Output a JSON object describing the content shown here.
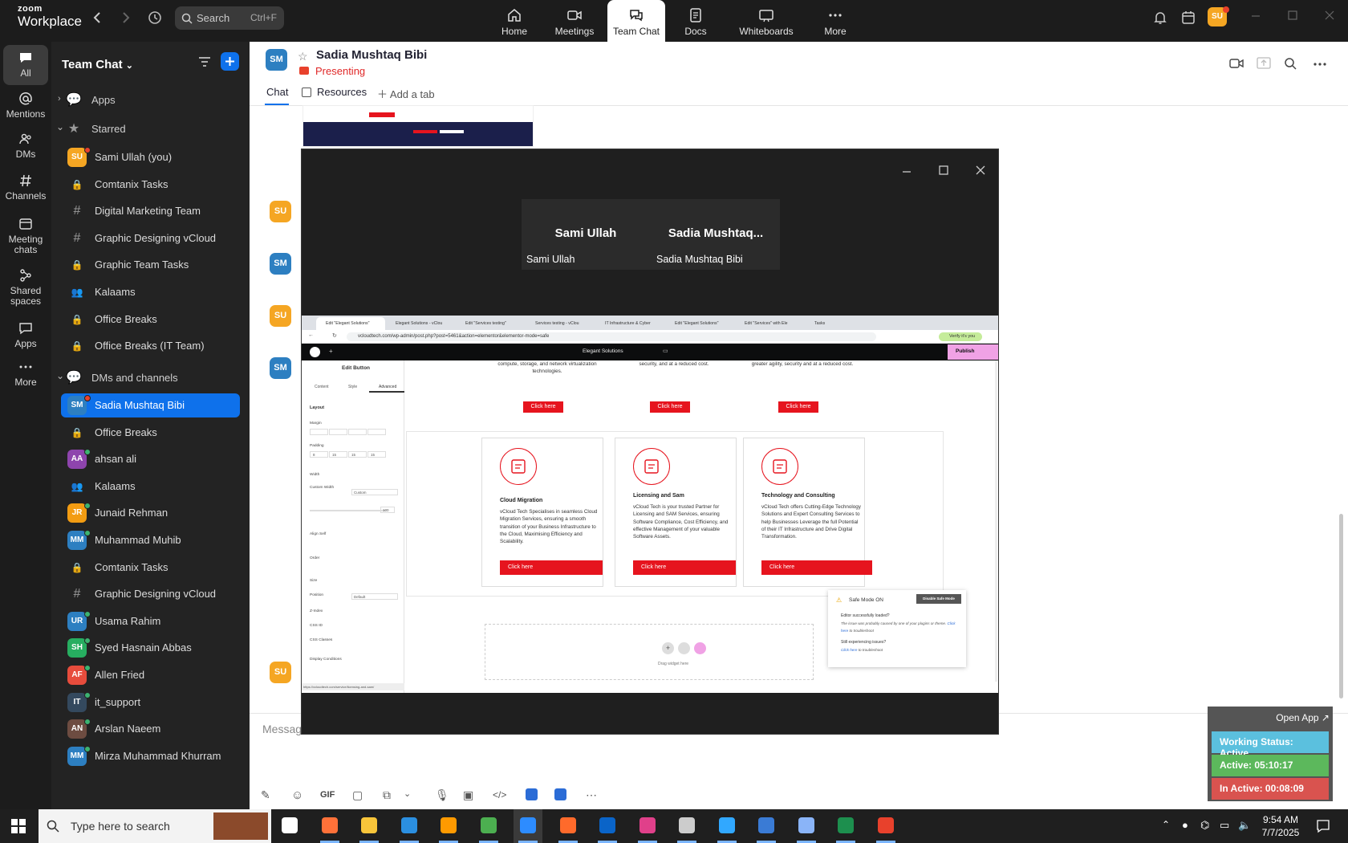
{
  "app": {
    "brand_top": "zoom",
    "brand_bottom": "Workplace"
  },
  "search": {
    "placeholder": "Search",
    "shortcut": "Ctrl+F"
  },
  "nav_tabs": [
    {
      "label": "Home",
      "icon": "home-icon"
    },
    {
      "label": "Meetings",
      "icon": "video-icon"
    },
    {
      "label": "Team Chat",
      "icon": "chat-icon",
      "active": true
    },
    {
      "label": "Docs",
      "icon": "doc-icon"
    },
    {
      "label": "Whiteboards",
      "icon": "whiteboard-icon"
    },
    {
      "label": "More",
      "icon": "more-icon"
    }
  ],
  "user_avatar": "SU",
  "rail": [
    {
      "label": "All"
    },
    {
      "label": "Mentions"
    },
    {
      "label": "DMs"
    },
    {
      "label": "Channels"
    },
    {
      "label": "Meeting chats"
    },
    {
      "label": "Shared spaces"
    },
    {
      "label": "Apps"
    },
    {
      "label": "More"
    }
  ],
  "sidebar": {
    "title": "Team Chat",
    "apps": "Apps",
    "starred_header": "Starred",
    "starred": [
      {
        "label": "Sami Ullah (you)",
        "avatar": "SU",
        "color": "#f5a623",
        "type": "avatar"
      },
      {
        "label": "Comtanix Tasks",
        "type": "lock"
      },
      {
        "label": "Digital Marketing Team",
        "type": "hash"
      },
      {
        "label": "Graphic Designing vCloud",
        "type": "hash"
      },
      {
        "label": "Graphic Team Tasks",
        "type": "lock"
      },
      {
        "label": "Kalaams",
        "type": "group"
      },
      {
        "label": "Office Breaks",
        "type": "lock"
      },
      {
        "label": "Office Breaks (IT Team)",
        "type": "lock"
      }
    ],
    "dms_header": "DMs and channels",
    "dms": [
      {
        "label": "Sadia Mushtaq Bibi",
        "avatar": "SM",
        "color": "#2d7fc1",
        "type": "avatar",
        "selected": true
      },
      {
        "label": "Office Breaks",
        "type": "lock"
      },
      {
        "label": "ahsan ali",
        "avatar": "AA",
        "color": "#8e44ad",
        "type": "avatar"
      },
      {
        "label": "Kalaams",
        "type": "group"
      },
      {
        "label": "Junaid Rehman",
        "avatar": "JR",
        "color": "#f39c12",
        "type": "avatar"
      },
      {
        "label": "Muhammad Muhib",
        "avatar": "MM",
        "color": "#2d7fc1",
        "type": "avatar"
      },
      {
        "label": "Comtanix Tasks",
        "type": "lock"
      },
      {
        "label": "Graphic Designing vCloud",
        "type": "hash"
      },
      {
        "label": "Usama Rahim",
        "avatar": "UR",
        "color": "#2d7fc1",
        "type": "avatar"
      },
      {
        "label": "Syed Hasnain Abbas",
        "avatar": "SH",
        "color": "#27ae60",
        "type": "avatar"
      },
      {
        "label": "Allen Fried",
        "avatar": "AF",
        "color": "#e74c3c",
        "type": "avatar"
      },
      {
        "label": "it_support",
        "avatar": "IT",
        "color": "#34495e",
        "type": "avatar"
      },
      {
        "label": "Arslan Naeem",
        "avatar": "AN",
        "color": "#6d4c41",
        "type": "avatar"
      },
      {
        "label": "Mirza Muhammad Khurram",
        "avatar": "MM",
        "color": "#2d7fc1",
        "type": "avatar"
      }
    ]
  },
  "chat": {
    "name": "Sadia Mushtaq Bibi",
    "avatar": "SM",
    "status": "Presenting",
    "tabs": {
      "chat": "Chat",
      "resources": "Resources",
      "add": "Add a tab"
    },
    "message_placeholder": "Message",
    "avatars": [
      "SU",
      "SM",
      "SU",
      "SM",
      "SU"
    ],
    "composer_gif": "GIF"
  },
  "share": {
    "tiles": [
      {
        "name": "Sami Ullah",
        "label": "Sami Ullah"
      },
      {
        "name": "Sadia  Mushtaq...",
        "label": "Sadia Mushtaq Bibi"
      }
    ],
    "browser": {
      "tabs": [
        "Edit \"Elegant Solutions\"",
        "Elegant Solutions - vClou",
        "Edit \"Services testing\"",
        "Services testing - vClou",
        "IT Infrastructure & Cyber",
        "Edit \"Elegant Solutions\"",
        "Edit \"Services\" with Ele",
        "Tasks"
      ],
      "url": "vcloudtech.com/wp-admin/post.php?post=5461&action=elementor&elementor-mode=safe",
      "verify": "Verify it's you"
    },
    "editor": {
      "site": "Elegant Solutions",
      "publish": "Publish",
      "panel_title": "Edit Button",
      "panel_tabs": [
        "Content",
        "Style",
        "Advanced"
      ],
      "layout": "Layout",
      "fields": [
        "Margin",
        "Padding",
        "Width",
        "Custom Width",
        "Align Self",
        "Order",
        "Size",
        "Position",
        "Z-Index",
        "CSS ID",
        "CSS Classes",
        "Display Conditions"
      ],
      "width_value": "Custom",
      "position_value": "Default",
      "custom_width_value": "100",
      "padding_values": [
        "8",
        "15",
        "15",
        "15"
      ],
      "status_url": "https://vcloudtech.com/service/licensing-and-sam/"
    },
    "top_cards": [
      "compute, storage, and network virtualization technologies.",
      "security, and at a reduced cost.",
      "greater agility, security and at a reduced cost."
    ],
    "cards": [
      {
        "title": "Cloud Migration",
        "body": "vCloud Tech Specialises in seamless Cloud Migration Services, ensuring a smooth transition of your Business Infrastructure to the Cloud, Maximising Efficiency and Scalability."
      },
      {
        "title": "Licensing and Sam",
        "body": "vCloud Tech is your trusted Partner for Licensing and SAM Services, ensuring Software Compliance, Cost Efficiency, and effective Management of your valuable Software Assets."
      },
      {
        "title": "Technology and Consulting",
        "body": "vCloud Tech offers Cutting-Edge Technology Solutions and Expert Consulting Services to help Businesses Leverage the full Potential of their IT Infrastructure and Drive Digital Transformation."
      }
    ],
    "button_label": "Click here",
    "safe_mode": {
      "title": "Safe Mode ON",
      "disable": "Disable Safe Mode",
      "q1": "Editor successfully loaded?",
      "a1": "The issue was probably caused by one of your plugins or theme.",
      "link1": "Click here",
      "a1b": "to troubleshoot",
      "q2": "Still experiencing issues?",
      "link2": "Click here",
      "a2b": "to troubleshoot"
    },
    "drag_text": "Drag widget here"
  },
  "monitor": {
    "open_app": "Open App ↗",
    "working": "Working Status: Active",
    "active": "Active: 05:10:17",
    "inactive": "In Active: 00:08:09",
    "colors": {
      "working": "#5bc0de",
      "active": "#5cb85c",
      "inactive": "#d9534f"
    }
  },
  "taskbar": {
    "search": "Type here to search",
    "time": "9:54 AM",
    "date": "7/7/2025"
  }
}
